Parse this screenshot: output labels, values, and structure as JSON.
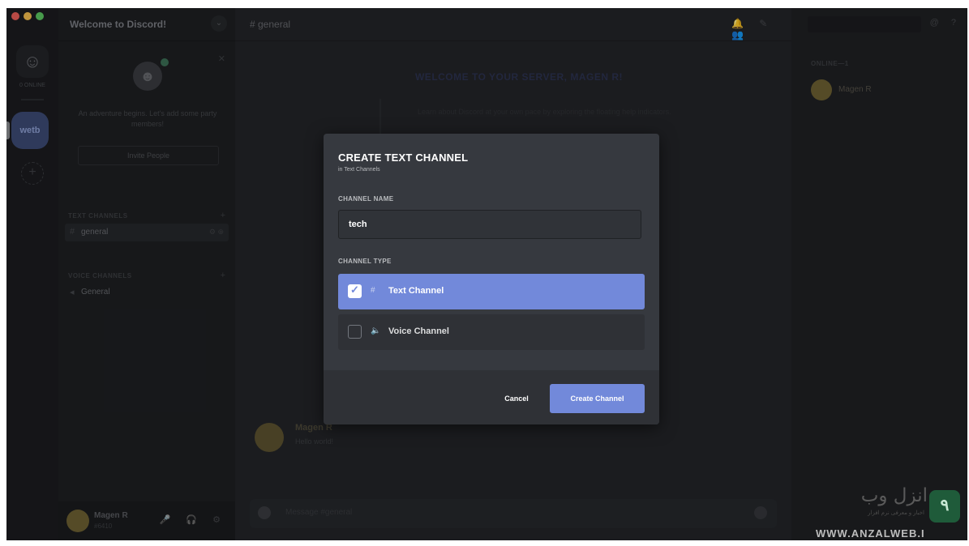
{
  "titlebar": {
    "dot_colors": [
      "#ec5f59",
      "#f5be4f",
      "#5bc761"
    ]
  },
  "rail": {
    "home_icon": "discord-logo-icon",
    "online_label": "0 ONLINE",
    "server_abbr": "wetb"
  },
  "sidebar": {
    "guild_title": "Welcome to Discord!",
    "invite_text": "An adventure begins. Let's add some party members!",
    "invite_button": "Invite People",
    "categories": [
      {
        "label": "TEXT CHANNELS",
        "channels": [
          {
            "name": "general",
            "active": true
          }
        ]
      },
      {
        "label": "VOICE CHANNELS",
        "channels": [
          {
            "name": "General",
            "active": false
          }
        ]
      }
    ],
    "user": {
      "name": "Magen R",
      "tag": "#6410"
    }
  },
  "main": {
    "channel_title": "# general",
    "welcome_title": "WELCOME TO YOUR SERVER, MAGEN R!",
    "welcome_text": "Learn about Discord at your own pace by exploring the floating help indicators.",
    "message": {
      "author": "Magen R",
      "text": "Hello world!"
    },
    "composer_placeholder": "Message #general"
  },
  "members": {
    "category": "ONLINE—1",
    "member_name": "Magen R"
  },
  "modal": {
    "title": "CREATE TEXT CHANNEL",
    "subtitle": "in Text Channels",
    "name_label": "CHANNEL NAME",
    "name_value": "tech",
    "type_label": "CHANNEL TYPE",
    "types": [
      {
        "label": "Text Channel",
        "icon": "#",
        "selected": true
      },
      {
        "label": "Voice Channel",
        "icon": "🔈",
        "selected": false
      }
    ],
    "cancel_label": "Cancel",
    "create_label": "Create Channel"
  },
  "watermark": {
    "brand": "انزل وب",
    "tagline": "اخبار و معرفی نرم افزار",
    "url": "WWW.ANZALWEB.I",
    "logo_glyph": "٩"
  },
  "colors": {
    "blurple": "#7289da",
    "modal_bg": "#36393f",
    "footer_bg": "#2f3136"
  }
}
